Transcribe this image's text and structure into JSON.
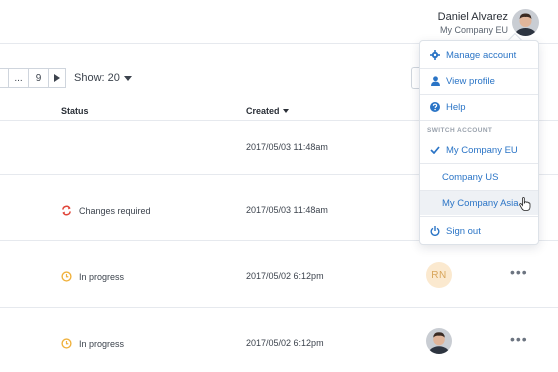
{
  "user": {
    "name": "Daniel Alvarez",
    "company": "My Company EU"
  },
  "pagination": {
    "ellipsis": "...",
    "last_page": "9",
    "show_label": "Show: 20"
  },
  "table": {
    "columns": {
      "status": "Status",
      "created": "Created"
    },
    "rows": [
      {
        "status": "",
        "created": "2017/05/03 11:48am"
      },
      {
        "status": "Changes required",
        "created": "2017/05/03 11:48am"
      },
      {
        "status": "In progress",
        "created": "2017/05/02 6:12pm",
        "assignee_initials": "RN"
      },
      {
        "status": "In progress",
        "created": "2017/05/02 6:12pm"
      }
    ]
  },
  "dropdown": {
    "items": [
      {
        "label": "Manage account",
        "icon": "gear-icon"
      },
      {
        "label": "View profile",
        "icon": "person-icon"
      },
      {
        "label": "Help",
        "icon": "help-icon"
      }
    ],
    "switch_heading": "SWITCH ACCOUNT",
    "accounts": [
      {
        "label": "My Company EU",
        "selected": true
      },
      {
        "label": "Company US",
        "selected": false
      },
      {
        "label": "My Company Asia",
        "selected": false,
        "hovered": true
      }
    ],
    "sign_out": {
      "label": "Sign out",
      "icon": "power-icon"
    }
  },
  "colors": {
    "link_blue": "#2a74c6",
    "changes_required_red": "#e0463a",
    "in_progress_amber": "#f0b13c",
    "initials_bg": "#fbe9cf"
  }
}
